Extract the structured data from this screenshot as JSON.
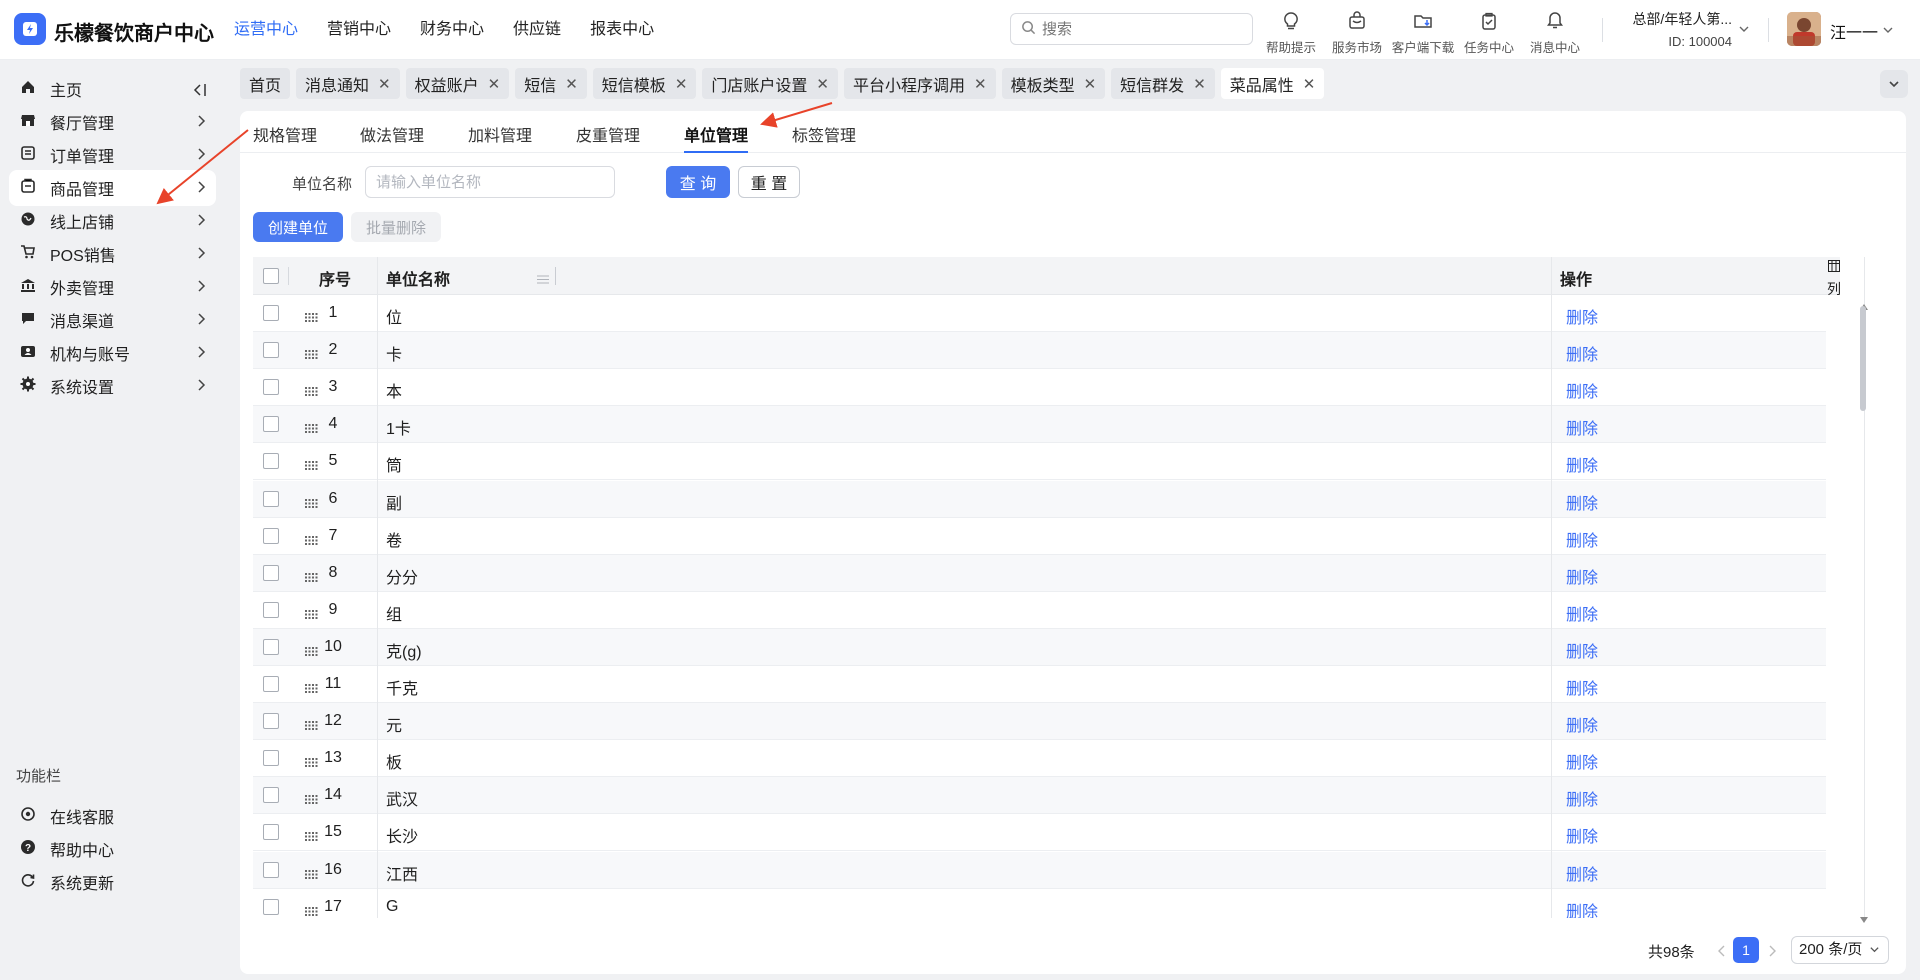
{
  "app": {
    "name": "乐檬餐饮商户中心"
  },
  "top_nav": [
    "运营中心",
    "营销中心",
    "财务中心",
    "供应链",
    "报表中心"
  ],
  "search": {
    "placeholder": "搜索"
  },
  "tools": [
    {
      "label": "帮助提示",
      "icon": "lightbulb-icon"
    },
    {
      "label": "服务市场",
      "icon": "shop-bag-icon"
    },
    {
      "label": "客户端下载",
      "icon": "folder-download-icon"
    },
    {
      "label": "任务中心",
      "icon": "clipboard-check-icon"
    },
    {
      "label": "消息中心",
      "icon": "bell-icon"
    }
  ],
  "org": {
    "name": "总部/年轻人第...",
    "id": "ID: 100004"
  },
  "user": {
    "name": "汪一一"
  },
  "sidebar": {
    "items": [
      {
        "label": "主页",
        "icon": "home-icon"
      },
      {
        "label": "餐厅管理",
        "icon": "store-icon"
      },
      {
        "label": "订单管理",
        "icon": "order-icon"
      },
      {
        "label": "商品管理",
        "icon": "goods-icon"
      },
      {
        "label": "线上店铺",
        "icon": "globe-icon"
      },
      {
        "label": "POS销售",
        "icon": "cart-icon"
      },
      {
        "label": "外卖管理",
        "icon": "bank-icon"
      },
      {
        "label": "消息渠道",
        "icon": "chat-icon"
      },
      {
        "label": "机构与账号",
        "icon": "contacts-icon"
      },
      {
        "label": "系统设置",
        "icon": "settings-icon"
      }
    ],
    "section_title": "功能栏",
    "bottom_items": [
      {
        "label": "在线客服",
        "icon": "headset-icon"
      },
      {
        "label": "帮助中心",
        "icon": "help-icon"
      },
      {
        "label": "系统更新",
        "icon": "refresh-icon"
      }
    ]
  },
  "tabs": [
    "首页",
    "消息通知",
    "权益账户",
    "短信",
    "短信模板",
    "门店账户设置",
    "平台小程序调用",
    "模板类型",
    "短信群发",
    "菜品属性"
  ],
  "subtabs": [
    "规格管理",
    "做法管理",
    "加料管理",
    "皮重管理",
    "单位管理",
    "标签管理"
  ],
  "filter": {
    "label": "单位名称",
    "placeholder": "请输入单位名称",
    "query_btn": "查 询",
    "reset_btn": "重 置"
  },
  "actions": {
    "create": "创建单位",
    "batch_delete": "批量删除"
  },
  "table": {
    "headers": {
      "index": "序号",
      "name": "单位名称",
      "op": "操作"
    },
    "column_setting": "列",
    "rows": [
      {
        "index": "1",
        "name": "位",
        "action": "删除"
      },
      {
        "index": "2",
        "name": "卡",
        "action": "删除"
      },
      {
        "index": "3",
        "name": "本",
        "action": "删除"
      },
      {
        "index": "4",
        "name": "1卡",
        "action": "删除"
      },
      {
        "index": "5",
        "name": "筒",
        "action": "删除"
      },
      {
        "index": "6",
        "name": "副",
        "action": "删除"
      },
      {
        "index": "7",
        "name": "卷",
        "action": "删除"
      },
      {
        "index": "8",
        "name": "分分",
        "action": "删除"
      },
      {
        "index": "9",
        "name": "组",
        "action": "删除"
      },
      {
        "index": "10",
        "name": "克(g)",
        "action": "删除"
      },
      {
        "index": "11",
        "name": "千克",
        "action": "删除"
      },
      {
        "index": "12",
        "name": "元",
        "action": "删除"
      },
      {
        "index": "13",
        "name": "板",
        "action": "删除"
      },
      {
        "index": "14",
        "name": "武汉",
        "action": "删除"
      },
      {
        "index": "15",
        "name": "长沙",
        "action": "删除"
      },
      {
        "index": "16",
        "name": "江西",
        "action": "删除"
      },
      {
        "index": "17",
        "name": "G",
        "action": "删除"
      }
    ]
  },
  "pagination": {
    "total": "共98条",
    "current": "1",
    "page_size": "200 条/页"
  },
  "colors": {
    "primary": "#2f6cf5",
    "link": "#3c6ef6",
    "annotation_arrow": "#e8432a"
  }
}
